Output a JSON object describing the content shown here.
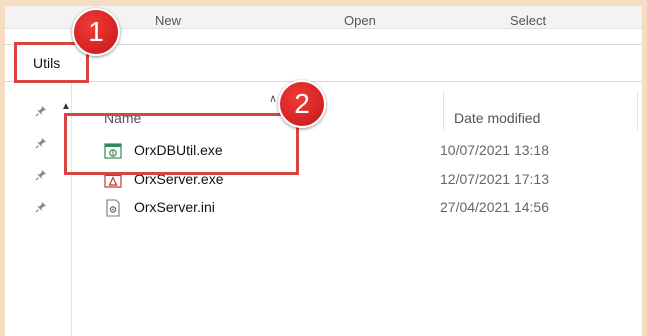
{
  "ribbon": {
    "new_label": "New",
    "open_label": "Open",
    "select_label": "Select"
  },
  "address": {
    "folder": "Utils"
  },
  "columns": {
    "name": "Name",
    "date_modified": "Date modified"
  },
  "files": [
    {
      "name": "OrxDBUtil.exe",
      "date": "10/07/2021 13:18",
      "icon": "exe-app-icon"
    },
    {
      "name": "OrxServer.exe",
      "date": "12/07/2021 17:13",
      "icon": "exe-app-icon"
    },
    {
      "name": "OrxServer.ini",
      "date": "27/04/2021 14:56",
      "icon": "ini-settings-icon"
    }
  ],
  "annotations": {
    "step1": "1",
    "step2": "2"
  },
  "colors": {
    "highlight": "#d8443f",
    "badge": "#d42a27",
    "background": "#f6dcc3"
  }
}
